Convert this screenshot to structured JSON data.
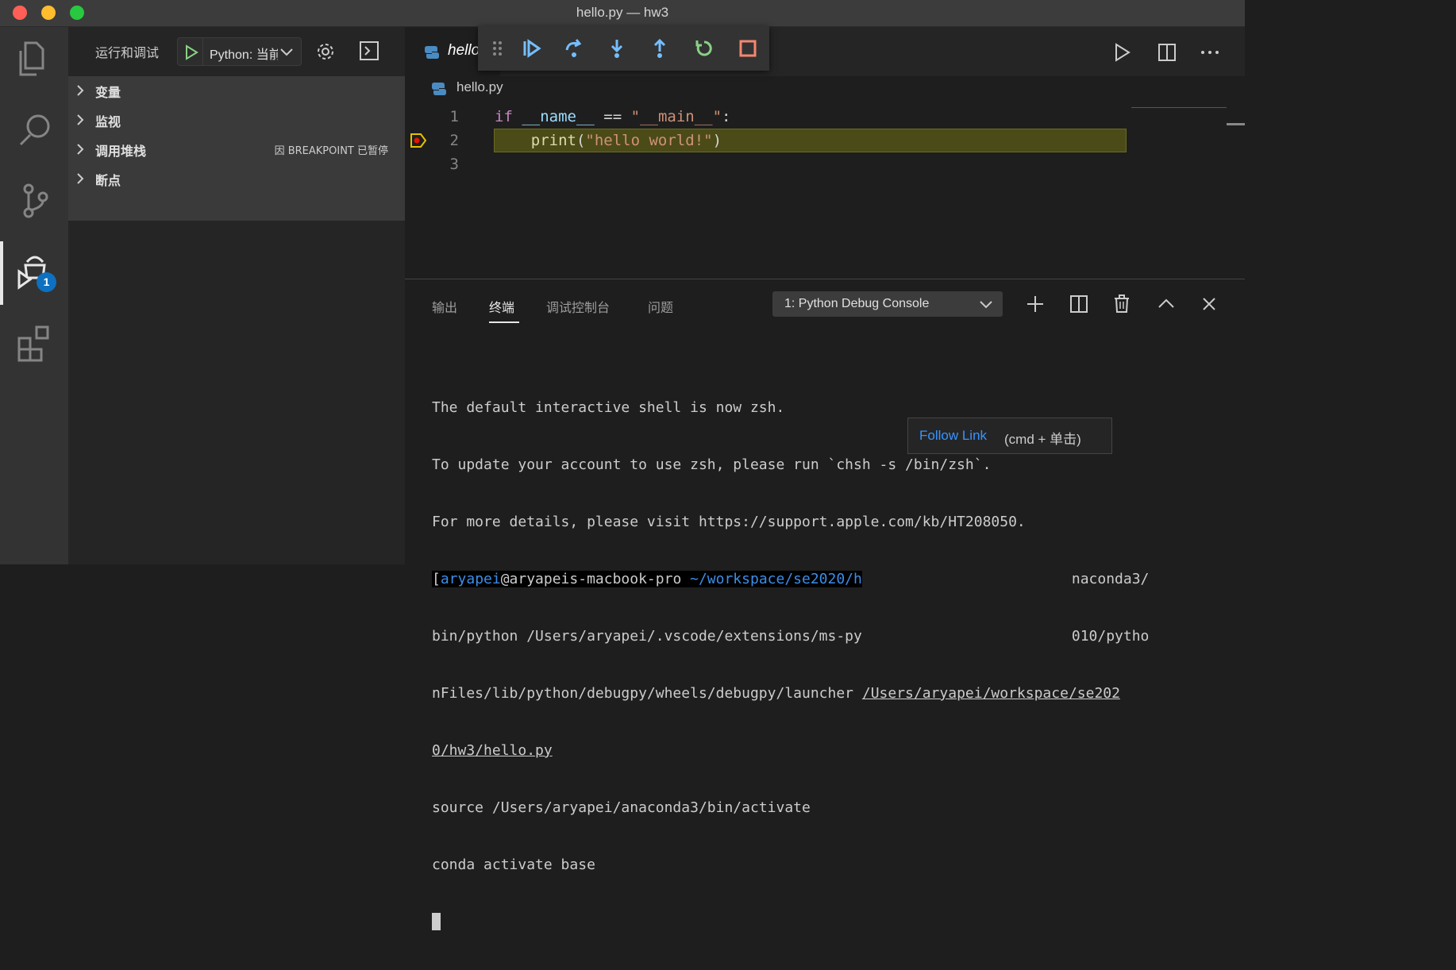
{
  "window": {
    "title": "hello.py — hw3"
  },
  "activity_bar": {
    "debug_badge": "1"
  },
  "sidebar": {
    "title": "运行和调试",
    "config_label": "Python: 当前文件",
    "sections": [
      {
        "label": "变量",
        "status": ""
      },
      {
        "label": "监视",
        "status": ""
      },
      {
        "label": "调用堆栈",
        "status": "因 BREAKPOINT 已暂停"
      },
      {
        "label": "断点",
        "status": ""
      }
    ]
  },
  "editor": {
    "tab_label": "hello.py",
    "breadcrumb": "hello.py",
    "line_numbers": [
      "1",
      "2",
      "3"
    ],
    "code": {
      "line1": {
        "kw": "if",
        "name": "__name__",
        "op": " == ",
        "str": "\"__main__\"",
        "colon": ":"
      },
      "line2": {
        "indent": "    ",
        "fn": "print",
        "open": "(",
        "str": "\"hello world!\"",
        "close": ")"
      }
    }
  },
  "panel": {
    "tabs": [
      "输出",
      "终端",
      "调试控制台",
      "问题"
    ],
    "active_tab": "终端",
    "terminal_select": "1: Python Debug Console",
    "terminal_lines": [
      "The default interactive shell is now zsh.",
      "To update your account to use zsh, please run `chsh -s /bin/zsh`.",
      "For more details, please visit https://support.apple.com/kb/HT208050.",
      "bin/python /Users/aryapei/.vscode/extensions/ms-py",
      "nFiles/lib/python/debugpy/wheels/debugpy/launcher ",
      "0/hw3/hello.py",
      "source /Users/aryapei/anaconda3/bin/activate",
      "conda activate base"
    ],
    "prompt": {
      "open_bracket": "[",
      "user": "aryapei",
      "host": "@aryapeis-macbook-pro",
      "path": " ~/workspace/se2020/h",
      "tail": "naconda3/"
    },
    "line2_tail": "010/pytho",
    "link_text": "/Users/aryapei/workspace/se202"
  },
  "tooltip": {
    "link": "Follow Link",
    "hint": "(cmd + 单击)"
  },
  "colors": {
    "accent": "#3794ff",
    "badge": "#0e70c0",
    "breakpoint": "#e5c100",
    "highlight": "#4b4b18"
  }
}
